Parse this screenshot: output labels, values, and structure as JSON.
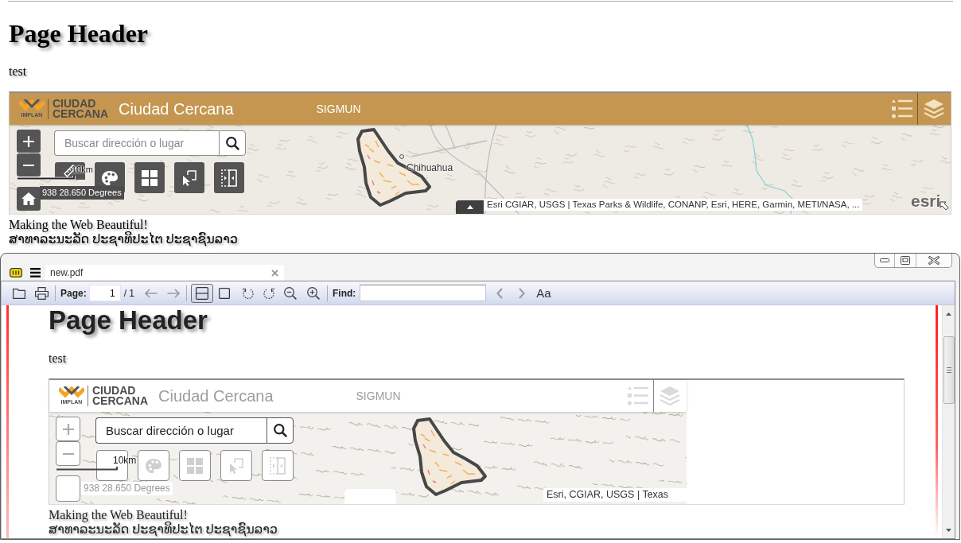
{
  "browser_page": {
    "heading": "Page Header",
    "paragraph": "test",
    "map_app": {
      "kind": "interactive",
      "logo_caption": "IMPLAN",
      "logo_lines": [
        "CIUDAD",
        "CERCANA"
      ],
      "title": "Ciudad Cercana",
      "subtitle": "SIGMUN",
      "search": {
        "placeholder": "Buscar dirección o lugar"
      },
      "scale": "10km",
      "coordinates": "938 28.650 Degrees",
      "place_label": "Chihuahua",
      "attribution": "Esri CGIAR, USGS | Texas Parks & Wildlife, CONANP, Esri, HERE, Garmin, METI/NASA, ...",
      "attribution_expanded": false,
      "brand": "esri"
    },
    "lines": [
      "Making the Web Beautiful!",
      "ສາທາລະນະລັດ ປະຊາທິປະໄຕ ປະຊາຊົນລາວ"
    ]
  },
  "pdf_viewer": {
    "tabs": [
      {
        "label": "new.pdf",
        "selected": true
      }
    ],
    "toolbar": {
      "page_label": "Page:",
      "page_value": "1",
      "page_total": "/ 1",
      "page_nav": [
        {
          "kind": "back",
          "disabled": true
        },
        {
          "kind": "forward",
          "disabled": true
        }
      ],
      "view_modes": [
        {
          "kind": "fit-width",
          "selected": true
        },
        {
          "kind": "single-page",
          "selected": false
        }
      ],
      "find_label": "Find:",
      "find_nav": [
        {
          "kind": "previous",
          "disabled": true
        },
        {
          "kind": "next",
          "disabled": true
        }
      ],
      "match_case": "Aa"
    },
    "document": {
      "heading": "Page Header",
      "paragraph": "test",
      "map_app": {
        "kind": "print",
        "logo_caption": "IMPLAN",
        "logo_lines": [
          "CIUDAD",
          "CERCANA"
        ],
        "title": "Ciudad Cercana",
        "subtitle": "SIGMUN",
        "search": {
          "placeholder": "Buscar dirección o lugar"
        },
        "scale": "10km",
        "coordinates": "938 28.650 Degrees",
        "attribution": "Esri, CGIAR, USGS | Texas"
      },
      "lines": [
        "Making the Web Beautiful!",
        "ສາທາລະນະລັດ ປະຊາທິປະໄຕ ປະຊາຊົນລາວ"
      ]
    }
  }
}
